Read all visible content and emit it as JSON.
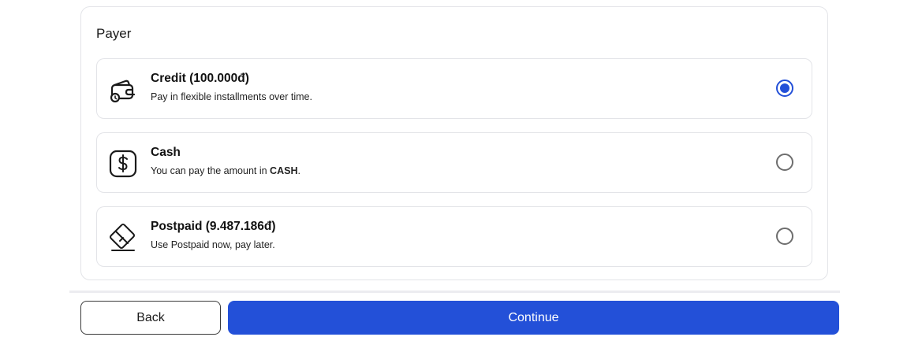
{
  "payer": {
    "title": "Payer",
    "options": [
      {
        "title": "Credit (100.000đ)",
        "subtitle": "Pay in flexible installments over time.",
        "icon": "wallet-icon",
        "selected": true
      },
      {
        "title": "Cash",
        "subtitle_prefix": "You can pay the amount in ",
        "subtitle_bold": "CASH",
        "subtitle_suffix": ".",
        "icon": "dollar-icon",
        "selected": false
      },
      {
        "title": "Postpaid (9.487.186đ)",
        "subtitle": "Use Postpaid now, pay later.",
        "icon": "card-icon",
        "selected": false
      }
    ]
  },
  "actions": {
    "back_label": "Back",
    "continue_label": "Continue"
  },
  "colors": {
    "accent": "#2350d8",
    "border": "#e3e4e8"
  }
}
